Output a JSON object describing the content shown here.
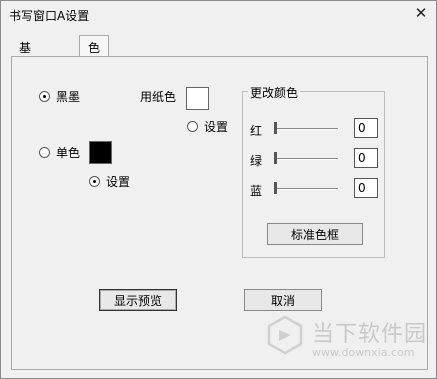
{
  "window": {
    "title": "书写窗口A设置",
    "close_glyph": "✕"
  },
  "tabs": [
    {
      "label": "基本设置",
      "active": false
    },
    {
      "label": "色彩",
      "active": true
    }
  ],
  "ink": {
    "option_black_label": "黑墨",
    "option_black_checked": true,
    "option_mono_label": "单色",
    "option_mono_checked": false,
    "mono_swatch_color": "#000000",
    "mono_set_label": "设置",
    "mono_set_checked": true
  },
  "paper": {
    "label": "用纸色",
    "swatch_color": "#ffffff",
    "set_label": "设置",
    "set_checked": false
  },
  "change_color": {
    "title": "更改颜色",
    "red": {
      "label": "红",
      "value": "0",
      "level": 0
    },
    "green": {
      "label": "绿",
      "value": "0",
      "level": 0
    },
    "blue": {
      "label": "蓝",
      "value": "0",
      "level": 0
    },
    "standard_button": "标准色框"
  },
  "footer": {
    "preview_button": "显示预览",
    "cancel_button": "取消"
  },
  "watermark": {
    "text_cn": "当下软件园",
    "url": "www.downxia.com"
  }
}
